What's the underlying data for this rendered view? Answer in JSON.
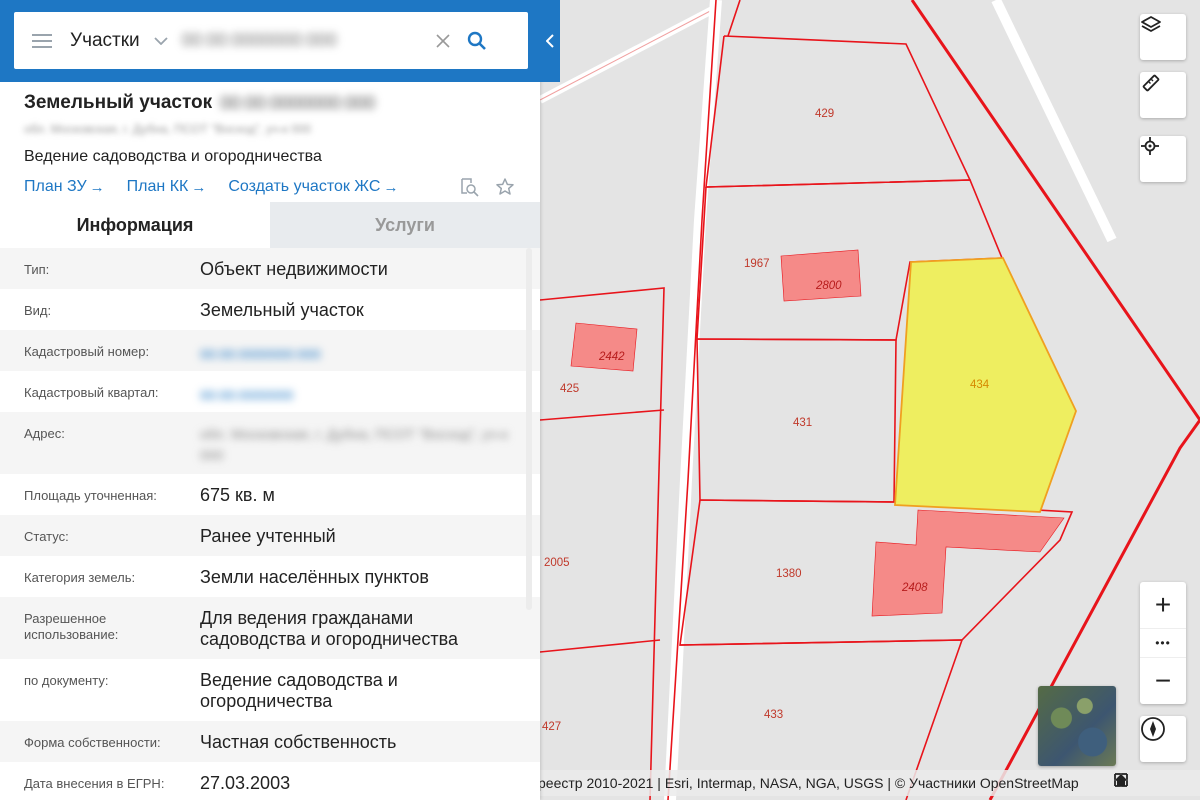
{
  "search": {
    "layer_label": "Участки",
    "query_blurred": "00:00:0000000:000",
    "placeholder": ""
  },
  "object": {
    "title": "Земельный участок",
    "cad_number_blurred": "00:00:0000000:000",
    "address_blurred": "обл. Московская, г. Дубна, ПСОТ \"Восход\", уч-к 000",
    "use": "Ведение садоводства и огородничества",
    "links": [
      {
        "label": "План ЗУ"
      },
      {
        "label": "План КК"
      },
      {
        "label": "Создать участок ЖС"
      }
    ]
  },
  "tabs": [
    {
      "label": "Информация",
      "active": true
    },
    {
      "label": "Услуги",
      "active": false
    }
  ],
  "info_rows": [
    {
      "label": "Тип:",
      "value": "Объект недвижимости"
    },
    {
      "label": "Вид:",
      "value": "Земельный участок"
    },
    {
      "label": "Кадастровый номер:",
      "value": "00:00:0000000:000",
      "blurred": true,
      "style": "link"
    },
    {
      "label": "Кадастровый квартал:",
      "value": "00:00:0000000",
      "blurred": true,
      "style": "link"
    },
    {
      "label": "Адрес:",
      "value": "обл. Московская, г. Дубна, ПСОТ \"Восход\", уч-к 000",
      "blurred": true,
      "style": "blur"
    },
    {
      "label": "Площадь уточненная:",
      "value": "675 кв. м"
    },
    {
      "label": "Статус:",
      "value": "Ранее учтенный"
    },
    {
      "label": "Категория земель:",
      "value": "Земли населённых пунктов"
    },
    {
      "label": "Разрешенное использование:",
      "value": "Для ведения гражданами садоводства и огородничества"
    },
    {
      "label": "по документу:",
      "value": "Ведение садоводства и огородничества"
    },
    {
      "label": "Форма собственности:",
      "value": "Частная собственность"
    },
    {
      "label": "Дата внесения в ЕГРН:",
      "value": "27.03.2003"
    }
  ],
  "map": {
    "parcel_labels": [
      "429",
      "1967",
      "425",
      "431",
      "434",
      "2005",
      "1380",
      "433",
      "427"
    ],
    "building_labels": [
      "2800",
      "2442",
      "2408"
    ],
    "selected_parcel": "434",
    "colors": {
      "boundary": "#e8141b",
      "building_fill": "#f58a88",
      "selected_fill": "#eeee60",
      "selected_stroke": "#f0a020",
      "road": "#ffffff"
    },
    "attribution": "реестр 2010-2021 | Esri, Intermap, NASA, NGA, USGS | © Участники OpenStreetMap"
  },
  "controls": {
    "layers_icon": "layers-icon",
    "ruler_icon": "ruler-icon",
    "locate_icon": "locate-icon",
    "zoom_in": "+",
    "zoom_out": "−",
    "more": "•••"
  }
}
